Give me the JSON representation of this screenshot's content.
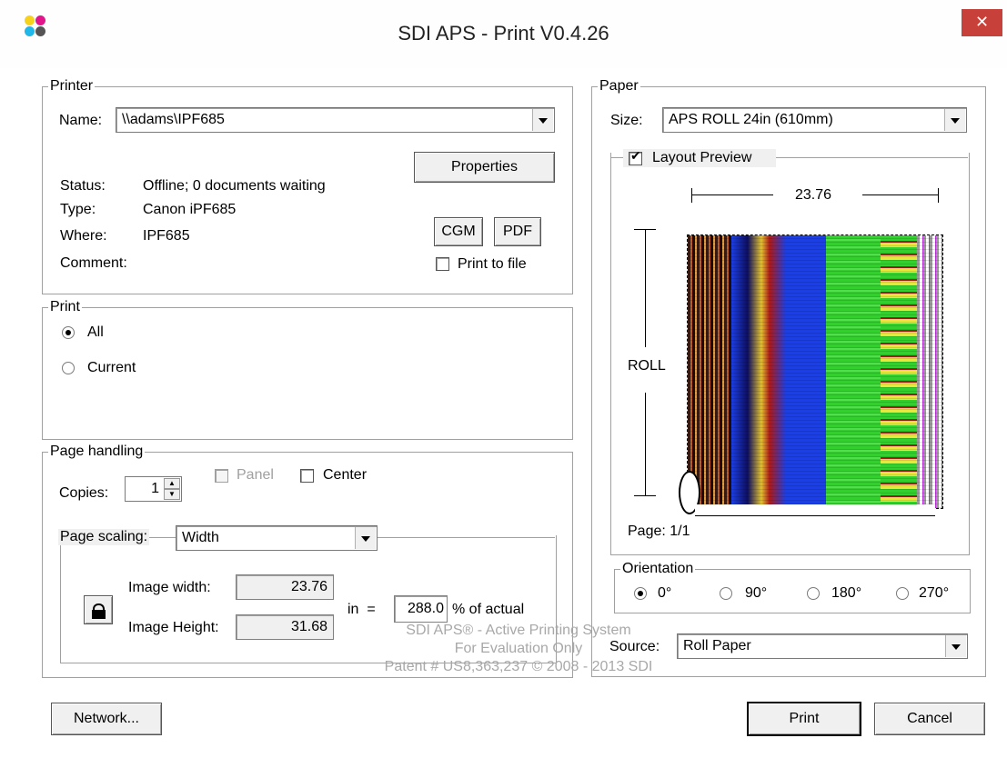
{
  "window": {
    "title": "SDI APS - Print V0.4.26",
    "close_label": "✕"
  },
  "printer": {
    "group_label": "Printer",
    "name_label": "Name:",
    "name_value": "\\\\adams\\IPF685",
    "properties_label": "Properties",
    "status_label": "Status:",
    "status_value": "Offline; 0 documents waiting",
    "type_label": "Type:",
    "type_value": "Canon iPF685",
    "where_label": "Where:",
    "where_value": "IPF685",
    "comment_label": "Comment:",
    "comment_value": "",
    "cgm_label": "CGM",
    "pdf_label": "PDF",
    "print_to_file_label": "Print to file",
    "print_to_file_checked": false
  },
  "print_range": {
    "group_label": "Print",
    "all_label": "All",
    "current_label": "Current",
    "selected": "All"
  },
  "page_handling": {
    "group_label": "Page handling",
    "copies_label": "Copies:",
    "copies_value": "1",
    "panel_label": "Panel",
    "panel_checked": false,
    "panel_enabled": false,
    "center_label": "Center",
    "center_checked": false,
    "scaling_label": "Page scaling:",
    "scaling_value": "Width",
    "image_width_label": "Image width:",
    "image_width_value": "23.76",
    "image_height_label": "Image Height:",
    "image_height_value": "31.68",
    "in_equals": "in  =",
    "percent_value": "288.0",
    "percent_label": "% of actual"
  },
  "paper": {
    "group_label": "Paper",
    "size_label": "Size:",
    "size_value": "APS ROLL 24in (610mm)",
    "layout_preview_label": "Layout Preview",
    "layout_preview_checked": true,
    "width_dimension": "23.76",
    "roll_label": "ROLL",
    "page_label": "Page: 1/1"
  },
  "orientation": {
    "group_label": "Orientation",
    "options": [
      "0°",
      "90°",
      "180°",
      "270°"
    ],
    "selected": "0°"
  },
  "source": {
    "label": "Source:",
    "value": "Roll Paper"
  },
  "footer": {
    "network_label": "Network...",
    "print_label": "Print",
    "cancel_label": "Cancel",
    "info_line1": "SDI APS® - Active Printing System",
    "info_line2": "For Evaluation Only",
    "info_line3": "Patent # US8,363,237 © 2008 - 2013 SDI"
  },
  "colors": {
    "close_button": "#c7403a",
    "dialog_bg": "#f0f0f0",
    "preview_blue": "#1a3ee8",
    "preview_green": "#2fd12a"
  }
}
